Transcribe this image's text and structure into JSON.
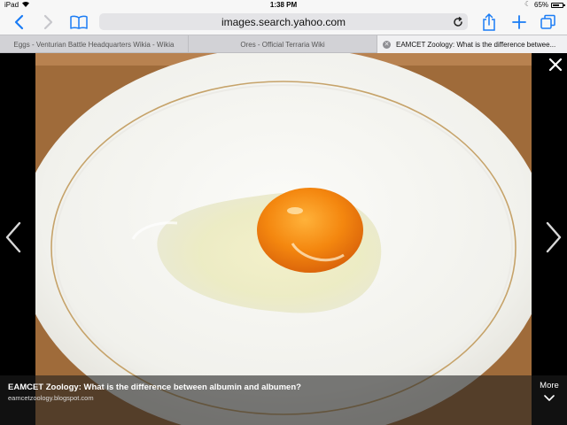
{
  "status_bar": {
    "carrier": "iPad",
    "time": "1:38 PM",
    "battery_text": "65%",
    "battery_level": 0.65
  },
  "toolbar": {
    "url": "images.search.yahoo.com",
    "icons": [
      "back-icon",
      "forward-icon",
      "bookmarks-icon",
      "reload-icon",
      "share-icon",
      "new-tab-icon",
      "tabs-icon"
    ]
  },
  "tabs": [
    {
      "title": "Eggs - Venturian Battle Headquarters Wikia - Wikia",
      "active": false
    },
    {
      "title": "Ores - Official Terraria Wiki",
      "active": false
    },
    {
      "title": "EAMCET Zoology: What is the difference betwee...",
      "active": true
    }
  ],
  "viewer": {
    "caption_title": "EAMCET Zoology: What is the difference between albumin and albumen?",
    "caption_source": "eamcetzoology.blogspot.com",
    "more_label": "More"
  },
  "colors": {
    "accent": "#1a7cf5",
    "yolk": "#f28a10",
    "plate": "#f4f4f0",
    "table_wood": "#b07a45"
  }
}
